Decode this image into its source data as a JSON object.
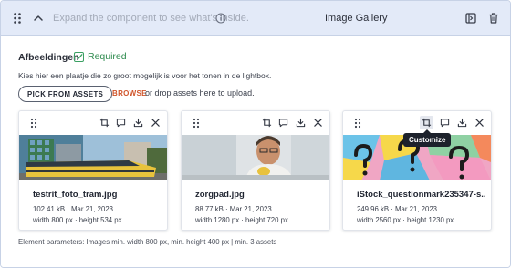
{
  "header": {
    "placeholder": "Expand the component to see what's inside.",
    "title": "Image Gallery"
  },
  "field": {
    "label": "Afbeeldingen",
    "required_label": "Required",
    "hint": "Kies hier een plaatje die zo groot mogelijk is voor het tonen in de lightbox."
  },
  "actions": {
    "pick_label": "PICK FROM ASSETS",
    "browse_label": "BROWSE",
    "drop_text": "or drop assets here to upload."
  },
  "cards": [
    {
      "filename": "testrit_foto_tram.jpg",
      "size_date": "102.41 kB · Mar 21, 2023",
      "dimensions": "width 800 px · height 534 px"
    },
    {
      "filename": "zorgpad.jpg",
      "size_date": "88.77 kB · Mar 21, 2023",
      "dimensions": "width 1280 px · height 720 px"
    },
    {
      "filename": "iStock_questionmark235347-s...",
      "size_date": "249.96 kB · Mar 21, 2023",
      "dimensions": "width 2560 px · height 1230 px"
    }
  ],
  "tooltip": "Customize",
  "params": "Element parameters: Images min. width 800 px, min. height 400 px | min. 3 assets",
  "icons": {
    "header": [
      "drag-handle-icon",
      "chevron-up-icon",
      "info-icon",
      "collapse-icon",
      "trash-icon"
    ],
    "card_toolbar": [
      "drag-handle-icon",
      "crop-icon",
      "comment-icon",
      "download-icon",
      "close-icon"
    ]
  },
  "colors": {
    "header_bg": "#e3eaf8",
    "required": "#2e8b4e",
    "browse": "#d0542a",
    "tooltip_bg": "#1d222c"
  }
}
